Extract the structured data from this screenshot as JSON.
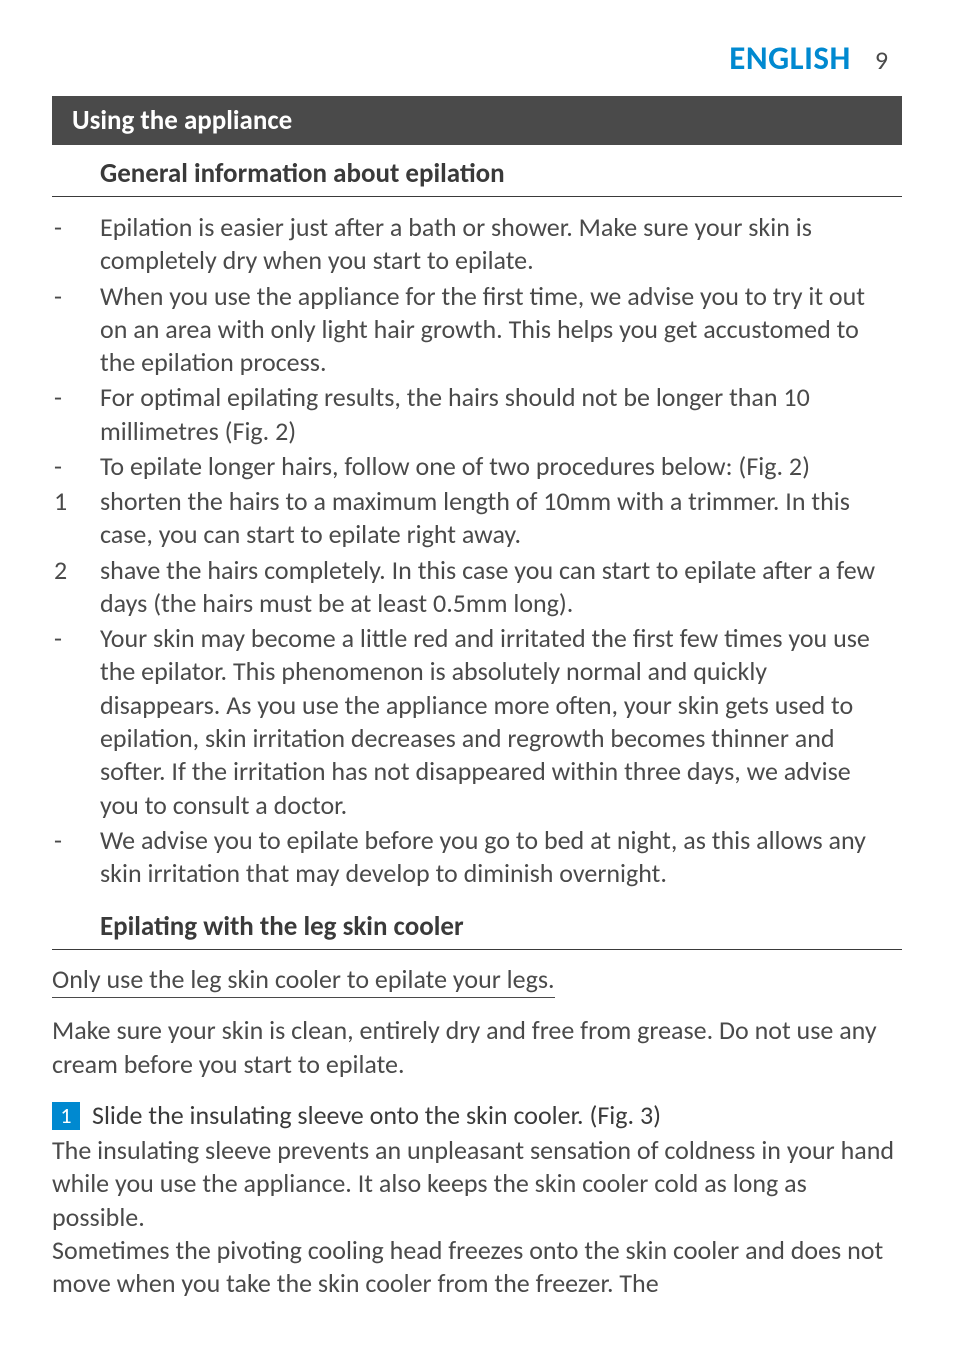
{
  "header": {
    "language": "ENGLISH",
    "page_number": "9"
  },
  "section_bar": "Using the appliance",
  "subsection1": "General information about epilation",
  "bullets": [
    {
      "marker": "-",
      "text": "Epilation is easier just after a bath or shower. Make sure your skin is completely dry when you start to epilate."
    },
    {
      "marker": "-",
      "text": "When you use the appliance for the first time, we advise you to try it out on an area with only light hair growth. This helps you get accustomed to the epilation process."
    },
    {
      "marker": "-",
      "text": "For optimal epilating results, the hairs should not be longer than 10 millimetres (Fig. 2)"
    },
    {
      "marker": "-",
      "text": "To epilate longer hairs, follow one of two procedures below: (Fig. 2)"
    },
    {
      "marker": "1",
      "text": "shorten the hairs to a maximum length of 10mm with a trimmer. In this case, you can start to epilate right away."
    },
    {
      "marker": "2",
      "text": "shave the hairs completely. In this case you can start to epilate after a few days (the hairs must be at least 0.5mm long)."
    },
    {
      "marker": "-",
      "text": "Your skin may become a little red and irritated the first few times you use the epilator. This phenomenon is absolutely normal and quickly disappears. As you use the appliance more often, your skin gets used to epilation, skin irritation decreases and regrowth becomes thinner and softer. If the irritation has not disappeared within three days, we advise you to consult a doctor."
    },
    {
      "marker": "-",
      "text": "We advise you to epilate before you go to bed at night, as this allows any skin irritation that may develop to diminish overnight."
    }
  ],
  "subsection2": "Epilating with the leg skin cooler",
  "underline_note": "Only use the leg skin cooler to epilate your legs.",
  "prep_para": "Make sure your skin is clean, entirely dry and free from grease. Do not use any cream before you start to epilate.",
  "step": {
    "num": "1",
    "text": "Slide the insulating sleeve onto the skin cooler.  (Fig. 3)"
  },
  "after_step": "The insulating sleeve prevents an unpleasant sensation of coldness in your hand while you use the appliance. It also keeps the skin cooler cold as long as possible.\nSometimes the pivoting cooling head freezes onto the skin cooler and does not move when you take the skin cooler from the freezer. The"
}
